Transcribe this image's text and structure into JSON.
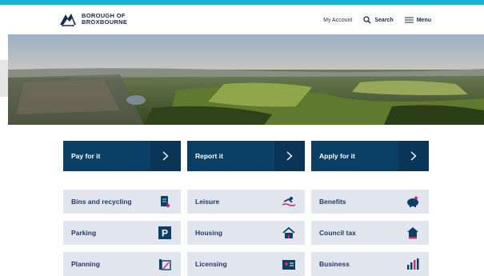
{
  "header": {
    "logo_line1": "BOROUGH OF",
    "logo_line2": "BROXBOURNE",
    "my_account": "My Account",
    "search": "Search",
    "menu": "Menu"
  },
  "primary_actions": [
    {
      "label": "Pay for it"
    },
    {
      "label": "Report it"
    },
    {
      "label": "Apply for it"
    }
  ],
  "services": [
    {
      "label": "Bins and recycling",
      "icon": "recycling-bin-icon"
    },
    {
      "label": "Leisure",
      "icon": "swimmer-icon"
    },
    {
      "label": "Benefits",
      "icon": "piggy-bank-icon"
    },
    {
      "label": "Parking",
      "icon": "parking-icon"
    },
    {
      "label": "Housing",
      "icon": "house-icon"
    },
    {
      "label": "Council tax",
      "icon": "council-tax-house-icon"
    },
    {
      "label": "Planning",
      "icon": "blueprint-icon"
    },
    {
      "label": "Licensing",
      "icon": "id-card-icon"
    },
    {
      "label": "Business",
      "icon": "bar-chart-icon"
    }
  ],
  "colors": {
    "accent_bar": "#19b5d0",
    "primary_tile": "#0c3f66",
    "service_tile": "#e1e6ee",
    "service_text": "#26376a",
    "icon_pink": "#d6287a"
  }
}
